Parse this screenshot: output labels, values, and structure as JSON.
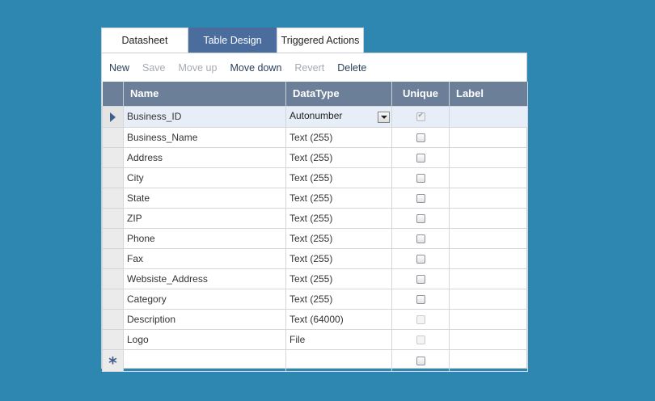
{
  "tabs": [
    {
      "label": "Datasheet",
      "active": false
    },
    {
      "label": "Table Design",
      "active": true
    },
    {
      "label": "Triggered Actions",
      "active": false
    }
  ],
  "toolbar": {
    "new": "New",
    "save": "Save",
    "move_up": "Move up",
    "move_down": "Move down",
    "revert": "Revert",
    "delete": "Delete"
  },
  "columns": {
    "name": "Name",
    "datatype": "DataType",
    "unique": "Unique",
    "label": "Label"
  },
  "rows": [
    {
      "name": "Business_ID",
      "datatype": "Autonumber",
      "unique": "checked-disabled",
      "label": ""
    },
    {
      "name": "Business_Name",
      "datatype": "Text (255)",
      "unique": "unchecked",
      "label": ""
    },
    {
      "name": "Address",
      "datatype": "Text (255)",
      "unique": "unchecked",
      "label": ""
    },
    {
      "name": "City",
      "datatype": "Text (255)",
      "unique": "unchecked",
      "label": ""
    },
    {
      "name": "State",
      "datatype": "Text (255)",
      "unique": "unchecked",
      "label": ""
    },
    {
      "name": "ZIP",
      "datatype": "Text (255)",
      "unique": "unchecked",
      "label": ""
    },
    {
      "name": "Phone",
      "datatype": "Text (255)",
      "unique": "unchecked",
      "label": ""
    },
    {
      "name": "Fax",
      "datatype": "Text (255)",
      "unique": "unchecked",
      "label": ""
    },
    {
      "name": "Websiste_Address",
      "datatype": "Text (255)",
      "unique": "unchecked",
      "label": ""
    },
    {
      "name": "Category",
      "datatype": "Text (255)",
      "unique": "unchecked",
      "label": ""
    },
    {
      "name": "Description",
      "datatype": "Text (64000)",
      "unique": "disabled",
      "label": ""
    },
    {
      "name": "Logo",
      "datatype": "File",
      "unique": "disabled",
      "label": ""
    }
  ],
  "new_row_marker": "*"
}
